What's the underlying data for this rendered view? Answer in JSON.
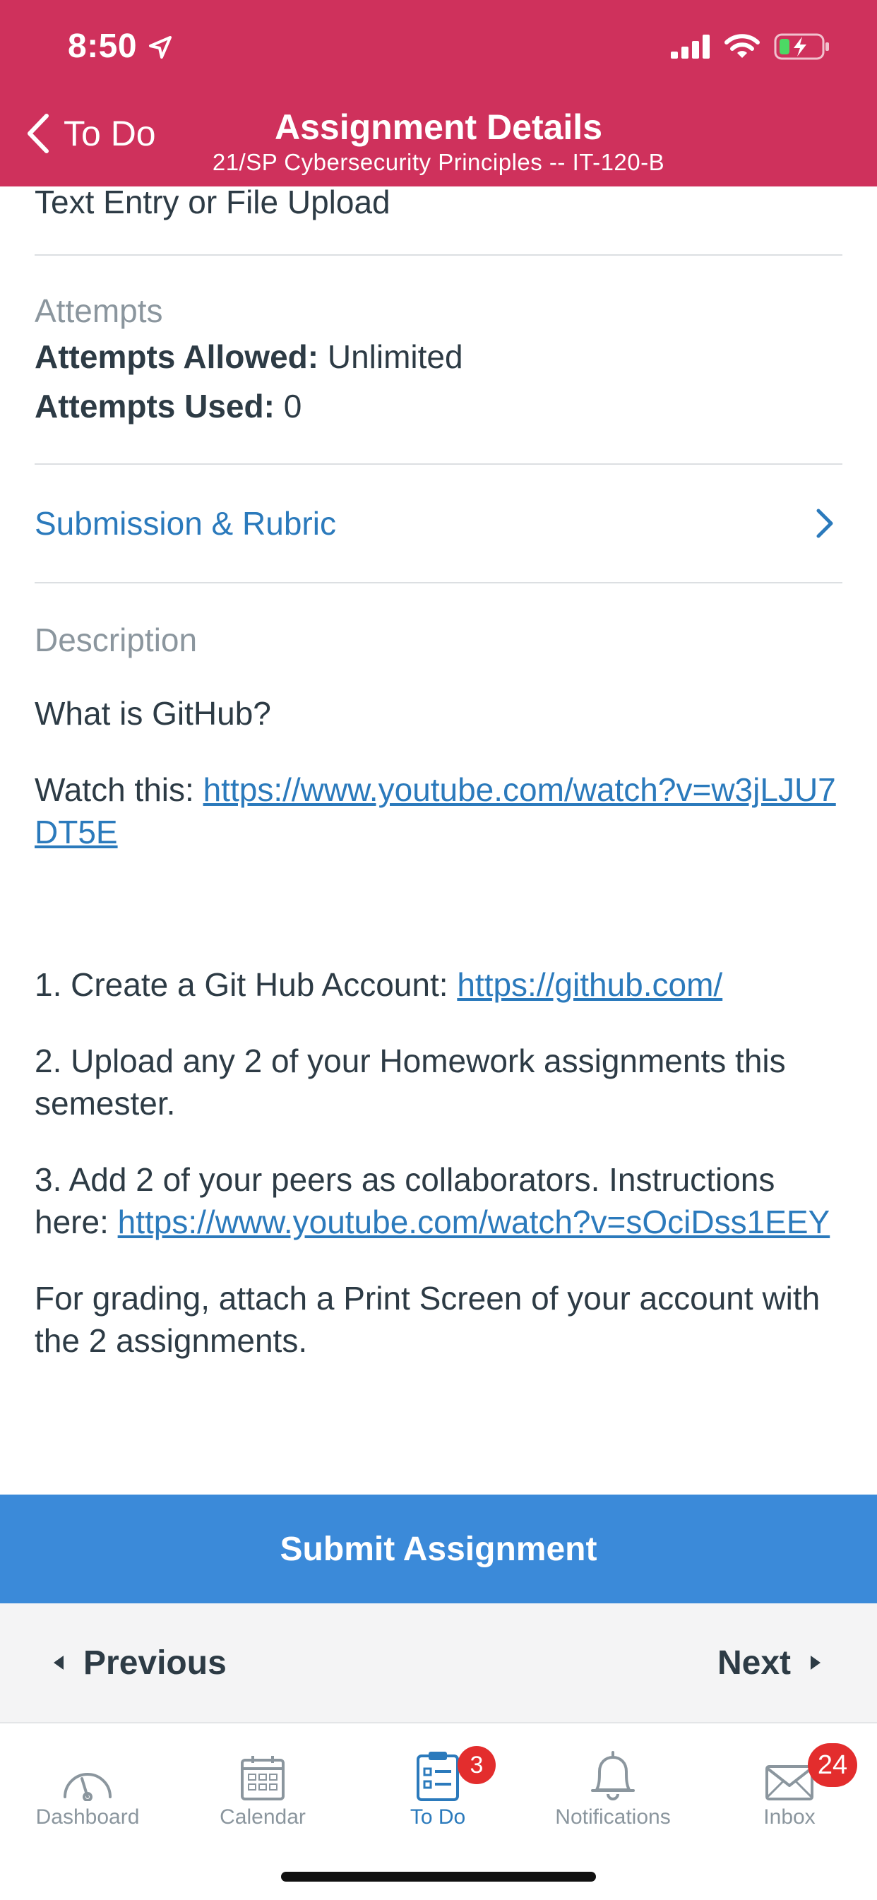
{
  "status_bar": {
    "time": "8:50"
  },
  "header": {
    "back_label": "To Do",
    "title": "Assignment Details",
    "subtitle": "21/SP Cybersecurity Principles -- IT-120-B"
  },
  "details": {
    "submission_type": "Text Entry or File Upload",
    "attempts": {
      "label": "Attempts",
      "allowed_label": "Attempts Allowed:",
      "allowed_value": "Unlimited",
      "used_label": "Attempts Used:",
      "used_value": "0"
    },
    "submission_rubric": "Submission & Rubric",
    "description": {
      "label": "Description",
      "question": "What is GitHub?",
      "watch_prefix": "Watch this:",
      "watch_link": "https://www.youtube.com/watch?v=w3jLJU7DT5E",
      "step1_prefix": "1. Create a Git Hub Account:",
      "step1_link": "https://github.com/",
      "step2": "2. Upload any 2 of your Homework assignments this semester.",
      "step3_prefix": "3. Add 2 of your peers as collaborators. Instructions here:",
      "step3_link": "https://www.youtube.com/watch?v=sOciDss1EEY",
      "grading": "For grading, attach a Print Screen of your account with the 2 assignments."
    }
  },
  "submit_label": "Submit Assignment",
  "pager": {
    "previous": "Previous",
    "next": "Next"
  },
  "tabs": [
    {
      "label": "Dashboard",
      "icon": "dashboard-icon"
    },
    {
      "label": "Calendar",
      "icon": "calendar-icon"
    },
    {
      "label": "To Do",
      "icon": "todo-icon",
      "badge": "3",
      "active": true
    },
    {
      "label": "Notifications",
      "icon": "bell-icon"
    },
    {
      "label": "Inbox",
      "icon": "mail-icon",
      "badge": "24"
    }
  ],
  "colors": {
    "header": "#cf315c",
    "link": "#2b7abc",
    "submit": "#3b8ad9",
    "badge": "#e32d2d"
  }
}
